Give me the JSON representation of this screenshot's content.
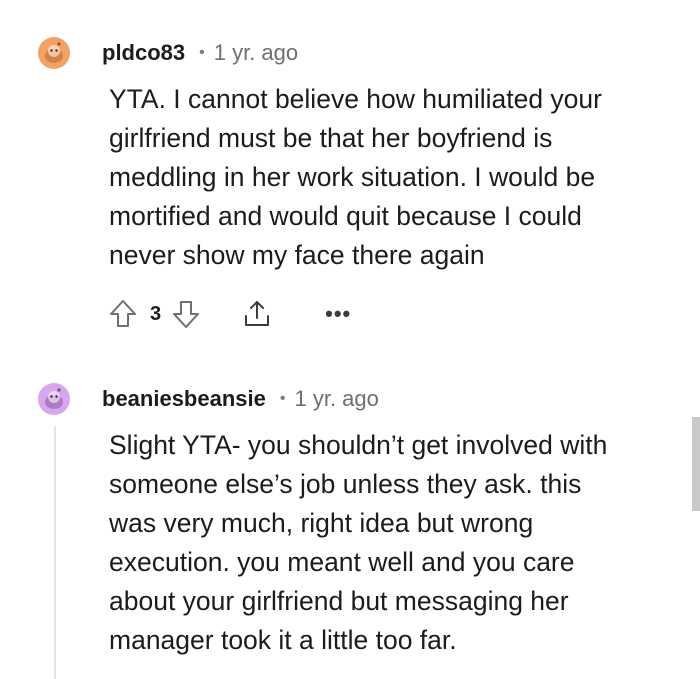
{
  "comments": [
    {
      "username": "pldco83",
      "separator": "•",
      "time": "1 yr. ago",
      "avatar_color": "#f4a261",
      "body_lines": [
        "YTA. I cannot believe how humiliated your",
        "girlfriend must be that her boyfriend is",
        "meddling in her work situation. I would be",
        "mortified and would quit because I could",
        "never show my face there again"
      ],
      "score": "3",
      "more_label": "•••",
      "icons": [
        "upvote-icon",
        "downvote-icon",
        "share-icon",
        "more-icon"
      ]
    },
    {
      "username": "beaniesbeansie",
      "separator": "•",
      "time": "1 yr. ago",
      "avatar_color": "#d7a6ef",
      "body_lines": [
        "Slight YTA- you shouldn’t get involved with",
        "someone else’s job unless they ask. this",
        "was very much, right idea but wrong",
        "execution. you meant well and you care",
        "about your girlfriend but messaging her",
        "manager took it a little too far."
      ]
    }
  ]
}
